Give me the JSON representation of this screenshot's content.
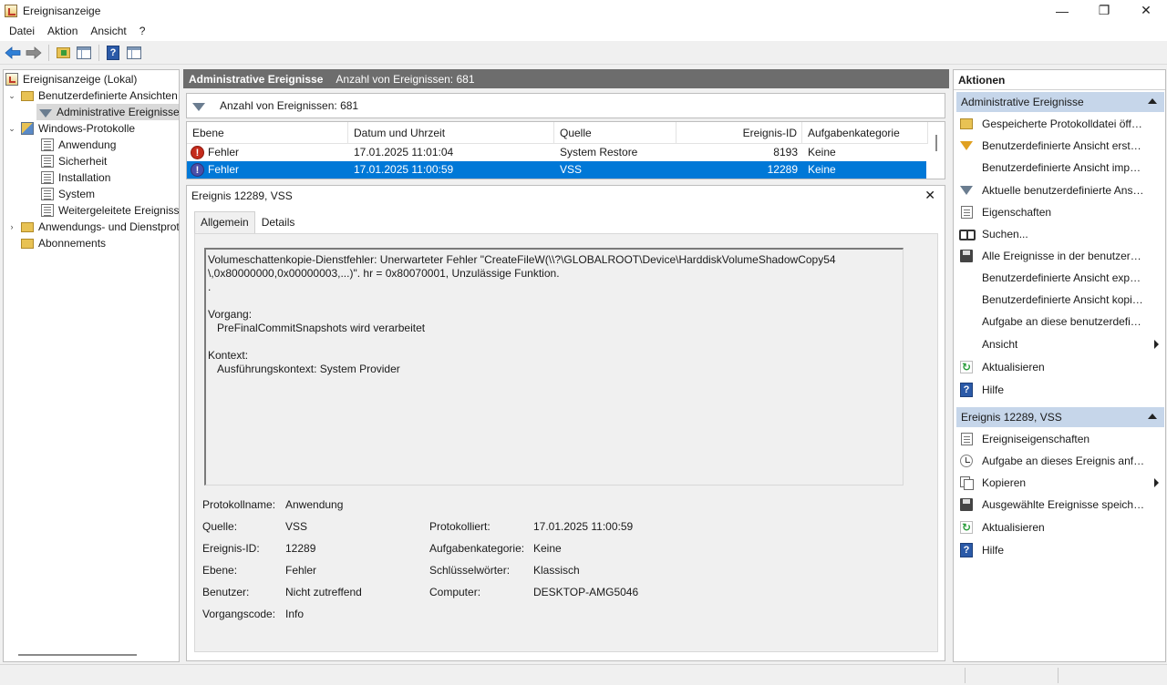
{
  "window": {
    "title": "Ereignisanzeige",
    "minimize_glyph": "—",
    "maximize_glyph": "❐",
    "close_glyph": "✕"
  },
  "menu": [
    "Datei",
    "Aktion",
    "Ansicht",
    "?"
  ],
  "toolbar": {
    "icons": [
      "back-arrow-icon",
      "forward-arrow-icon",
      "open-folder-icon",
      "show-hide-console-tree-icon",
      "help-icon",
      "show-hide-action-pane-icon"
    ],
    "help_glyph": "?"
  },
  "tree": {
    "items": [
      {
        "label": "Ereignisanzeige (Lokal)",
        "icon": "event-viewer-icon",
        "expander": ""
      },
      {
        "label": "Benutzerdefinierte Ansichten",
        "icon": "folder-icon",
        "expander": "expanded"
      },
      {
        "label": "Administrative Ereignisse",
        "icon": "filter-icon",
        "expander": "",
        "selected": true
      },
      {
        "label": "Windows-Protokolle",
        "icon": "windows-logs-folder-icon",
        "expander": "expanded"
      },
      {
        "label": "Anwendung",
        "icon": "log-icon",
        "expander": ""
      },
      {
        "label": "Sicherheit",
        "icon": "log-icon",
        "expander": ""
      },
      {
        "label": "Installation",
        "icon": "log-icon",
        "expander": ""
      },
      {
        "label": "System",
        "icon": "log-icon",
        "expander": ""
      },
      {
        "label": "Weitergeleitete Ereignisse",
        "icon": "log-icon",
        "expander": ""
      },
      {
        "label": "Anwendungs- und Dienstprotokolle",
        "icon": "folder-icon",
        "expander": "collapsed"
      },
      {
        "label": "Abonnements",
        "icon": "subscriptions-icon",
        "expander": ""
      }
    ]
  },
  "center": {
    "header_title": "Administrative Ereignisse",
    "header_count": "Anzahl von Ereignissen: 681",
    "filter_text": "Anzahl von Ereignissen: 681",
    "columns": [
      "Ebene",
      "Datum und Uhrzeit",
      "Quelle",
      "Ereignis-ID",
      "Aufgabenkategorie"
    ],
    "rows": [
      {
        "level": "Fehler",
        "datetime": "17.01.2025 11:01:04",
        "source": "System Restore",
        "event_id": "8193",
        "category": "Keine",
        "selected": false
      },
      {
        "level": "Fehler",
        "datetime": "17.01.2025 11:00:59",
        "source": "VSS",
        "event_id": "12289",
        "category": "Keine",
        "selected": true
      }
    ],
    "error_glyph": "!"
  },
  "detail": {
    "title": "Ereignis 12289, VSS",
    "close_glyph": "✕",
    "tabs": [
      "Allgemein",
      "Details"
    ],
    "message": "Volumeschattenkopie-Dienstfehler: Unerwarteter Fehler \"CreateFileW(\\\\?\\GLOBALROOT\\Device\\HarddiskVolumeShadowCopy54\n\\,0x80000000,0x00000003,...)\". hr = 0x80070001, Unzulässige Funktion.\n.\n\nVorgang:\n   PreFinalCommitSnapshots wird verarbeitet\n\nKontext:\n   Ausführungskontext: System Provider",
    "props": {
      "logname_label": "Protokollname:",
      "logname": "Anwendung",
      "source_label": "Quelle:",
      "source": "VSS",
      "logged_label": "Protokolliert:",
      "logged": "17.01.2025 11:00:59",
      "eventid_label": "Ereignis-ID:",
      "eventid": "12289",
      "taskcat_label": "Aufgabenkategorie:",
      "taskcat": "Keine",
      "level_label": "Ebene:",
      "level": "Fehler",
      "keywords_label": "Schlüsselwörter:",
      "keywords": "Klassisch",
      "user_label": "Benutzer:",
      "user": "Nicht zutreffend",
      "computer_label": "Computer:",
      "computer": "DESKTOP-AMG5046",
      "opcode_label": "Vorgangscode:",
      "opcode": "Info"
    }
  },
  "actions": {
    "header": "Aktionen",
    "section1": {
      "title": "Administrative Ereignisse",
      "items": [
        {
          "label": "Gespeicherte Protokolldatei öffnen...",
          "icon": "open-folder-icon"
        },
        {
          "label": "Benutzerdefinierte Ansicht erstellen...",
          "icon": "create-custom-view-icon"
        },
        {
          "label": "Benutzerdefinierte Ansicht importieren...",
          "icon": ""
        },
        {
          "label": "Aktuelle benutzerdefinierte Ansicht filtern...",
          "icon": "filter-icon"
        },
        {
          "label": "Eigenschaften",
          "icon": "properties-icon"
        },
        {
          "label": "Suchen...",
          "icon": "find-icon"
        },
        {
          "label": "Alle Ereignisse in der benutzerdefinierten Ansicht speichern unter...",
          "icon": "save-icon"
        },
        {
          "label": "Benutzerdefinierte Ansicht exportieren...",
          "icon": ""
        },
        {
          "label": "Benutzerdefinierte Ansicht kopieren...",
          "icon": ""
        },
        {
          "label": "Aufgabe an diese benutzerdefinierte Ansicht anfügen...",
          "icon": ""
        },
        {
          "label": "Ansicht",
          "icon": "",
          "submenu": true
        },
        {
          "label": "Aktualisieren",
          "icon": "refresh-icon"
        },
        {
          "label": "Hilfe",
          "icon": "help-icon",
          "submenu": true
        }
      ]
    },
    "section2": {
      "title": "Ereignis 12289, VSS",
      "items": [
        {
          "label": "Ereigniseigenschaften",
          "icon": "properties-icon"
        },
        {
          "label": "Aufgabe an dieses Ereignis anfügen...",
          "icon": "task-icon"
        },
        {
          "label": "Kopieren",
          "icon": "copy-icon",
          "submenu": true
        },
        {
          "label": "Ausgewählte Ereignisse speichern...",
          "icon": "save-icon"
        },
        {
          "label": "Aktualisieren",
          "icon": "refresh-icon"
        },
        {
          "label": "Hilfe",
          "icon": "help-icon",
          "submenu": true
        }
      ]
    },
    "refresh_glyph": "↻",
    "help_glyph": "?"
  },
  "colors": {
    "selection": "#0078d7",
    "header_bar": "#6d6d6d",
    "action_section": "#c6d6ea",
    "error": "#c42b1c"
  }
}
